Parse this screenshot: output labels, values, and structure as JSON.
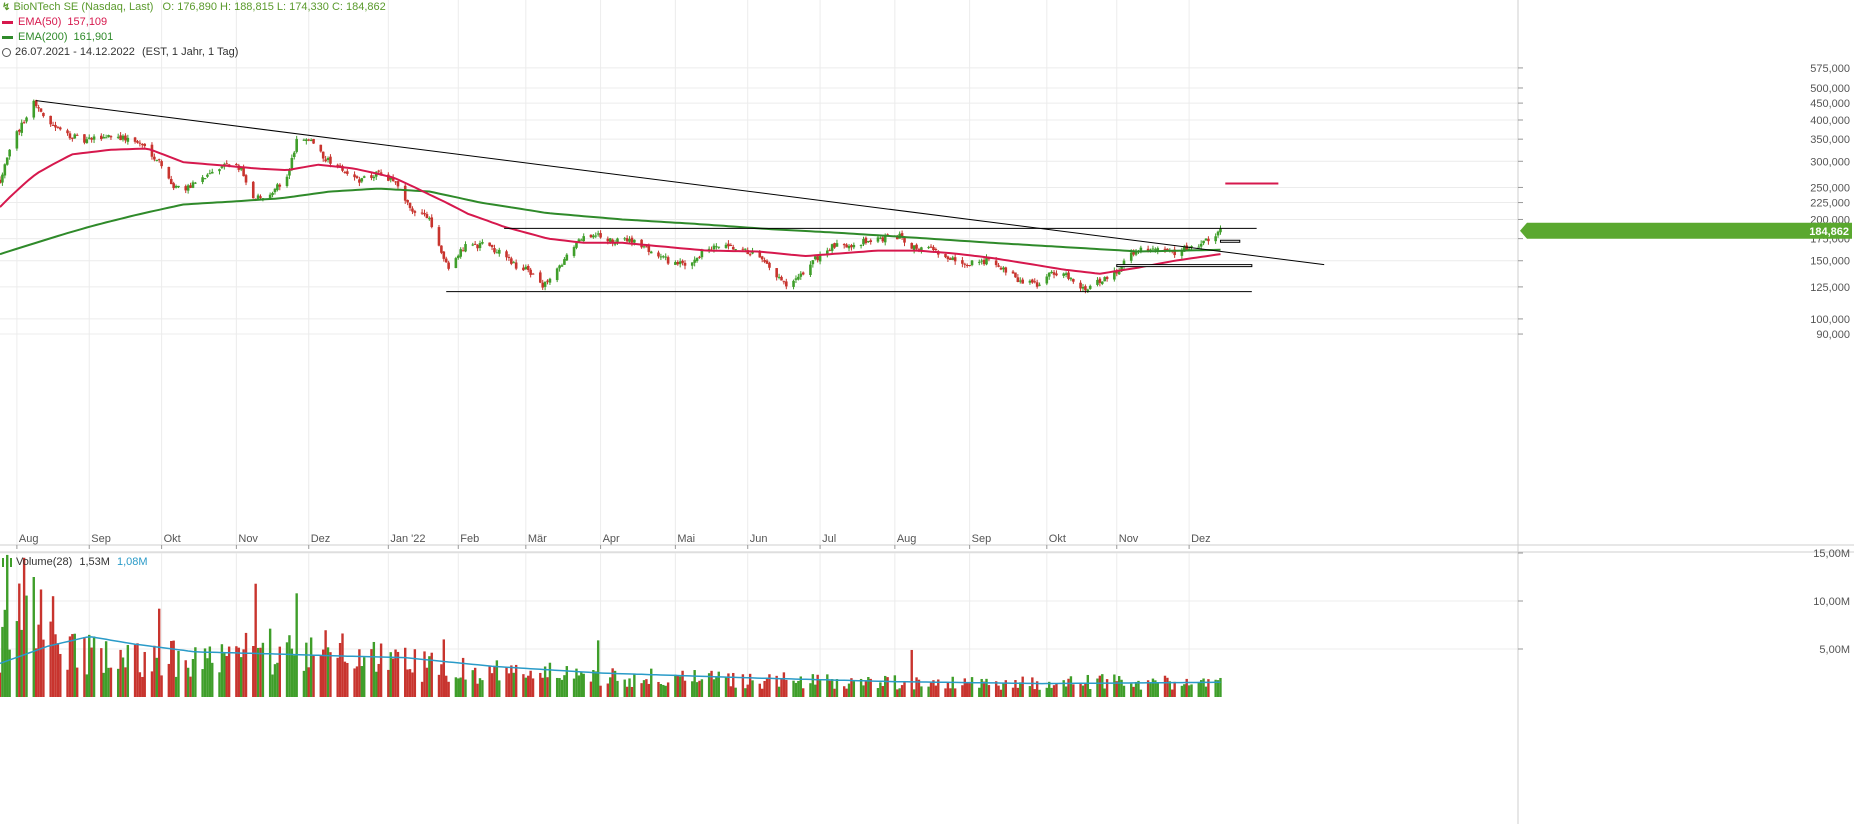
{
  "header": {
    "instrument": "BioNTech SE (Nasdaq, Last)",
    "ohlc": "O: 176,890  H: 188,815  L: 174,330  C: 184,862",
    "ema50_label": "EMA(50)",
    "ema50_value": "157,109",
    "ema200_label": "EMA(200)",
    "ema200_value": "161,901",
    "range": "26.07.2021 - 14.12.2022",
    "range_detail": "(EST, 1 Jahr, 1 Tag)"
  },
  "volume_header": {
    "label": "Volume(28)",
    "value1": "1,53M",
    "value2": "1,08M"
  },
  "colors": {
    "up": "#3f9e2a",
    "down": "#c8342e",
    "ema50": "#d6184d",
    "ema200": "#2f8a2a",
    "vol_avg": "#2a9bc8",
    "grid": "#ececec",
    "text": "#555555",
    "header_instrument": "#5a9a2c",
    "last_price_bg": "#5aa82f"
  },
  "chart_data": [
    {
      "type": "candlestick",
      "title": "BioNTech SE (Nasdaq, Last)",
      "scale": "log",
      "ylim": [
        85,
        600
      ],
      "xlim": [
        "2021-07-26",
        "2022-12-14"
      ],
      "y_ticks": [
        {
          "value": 575,
          "label": "575,000"
        },
        {
          "value": 500,
          "label": "500,000"
        },
        {
          "value": 450,
          "label": "450,000"
        },
        {
          "value": 400,
          "label": "400,000"
        },
        {
          "value": 350,
          "label": "350,000"
        },
        {
          "value": 300,
          "label": "300,000"
        },
        {
          "value": 250,
          "label": "250,000"
        },
        {
          "value": 225,
          "label": "225,000"
        },
        {
          "value": 200,
          "label": "200,000"
        },
        {
          "value": 175,
          "label": "175,000"
        },
        {
          "value": 150,
          "label": "150,000"
        },
        {
          "value": 125,
          "label": "125,000"
        },
        {
          "value": 100,
          "label": "100,000"
        },
        {
          "value": 90,
          "label": "90,000"
        }
      ],
      "x_ticks": [
        {
          "date": "2021-08-02",
          "label": "Aug"
        },
        {
          "date": "2021-09-01",
          "label": "Sep"
        },
        {
          "date": "2021-10-01",
          "label": "Okt"
        },
        {
          "date": "2021-11-01",
          "label": "Nov"
        },
        {
          "date": "2021-12-01",
          "label": "Dez"
        },
        {
          "date": "2022-01-03",
          "label": "Jan '22"
        },
        {
          "date": "2022-02-01",
          "label": "Feb"
        },
        {
          "date": "2022-03-01",
          "label": "Mär"
        },
        {
          "date": "2022-04-01",
          "label": "Apr"
        },
        {
          "date": "2022-05-02",
          "label": "Mai"
        },
        {
          "date": "2022-06-01",
          "label": "Jun"
        },
        {
          "date": "2022-07-01",
          "label": "Jul"
        },
        {
          "date": "2022-08-01",
          "label": "Aug"
        },
        {
          "date": "2022-09-01",
          "label": "Sep"
        },
        {
          "date": "2022-10-03",
          "label": "Okt"
        },
        {
          "date": "2022-11-01",
          "label": "Nov"
        },
        {
          "date": "2022-12-01",
          "label": "Dez"
        }
      ],
      "price_anchors": [
        {
          "date": "2021-07-26",
          "close": 262
        },
        {
          "date": "2021-07-30",
          "close": 330
        },
        {
          "date": "2021-08-04",
          "close": 385
        },
        {
          "date": "2021-08-09",
          "close": 455
        },
        {
          "date": "2021-08-13",
          "close": 410
        },
        {
          "date": "2021-08-20",
          "close": 370
        },
        {
          "date": "2021-08-30",
          "close": 345
        },
        {
          "date": "2021-09-10",
          "close": 360
        },
        {
          "date": "2021-09-20",
          "close": 345
        },
        {
          "date": "2021-09-24",
          "close": 332
        },
        {
          "date": "2021-09-30",
          "close": 300
        },
        {
          "date": "2021-10-05",
          "close": 252
        },
        {
          "date": "2021-10-12",
          "close": 250
        },
        {
          "date": "2021-10-20",
          "close": 270
        },
        {
          "date": "2021-10-27",
          "close": 290
        },
        {
          "date": "2021-11-03",
          "close": 288
        },
        {
          "date": "2021-11-08",
          "close": 228
        },
        {
          "date": "2021-11-15",
          "close": 240
        },
        {
          "date": "2021-11-22",
          "close": 265
        },
        {
          "date": "2021-11-26",
          "close": 345
        },
        {
          "date": "2021-12-01",
          "close": 355
        },
        {
          "date": "2021-12-08",
          "close": 305
        },
        {
          "date": "2021-12-15",
          "close": 285
        },
        {
          "date": "2021-12-22",
          "close": 262
        },
        {
          "date": "2021-12-30",
          "close": 275
        },
        {
          "date": "2022-01-05",
          "close": 260
        },
        {
          "date": "2022-01-12",
          "close": 215
        },
        {
          "date": "2022-01-19",
          "close": 205
        },
        {
          "date": "2022-01-25",
          "close": 160
        },
        {
          "date": "2022-01-28",
          "close": 145
        },
        {
          "date": "2022-02-04",
          "close": 165
        },
        {
          "date": "2022-02-11",
          "close": 168
        },
        {
          "date": "2022-02-18",
          "close": 160
        },
        {
          "date": "2022-02-25",
          "close": 145
        },
        {
          "date": "2022-03-04",
          "close": 138
        },
        {
          "date": "2022-03-08",
          "close": 126
        },
        {
          "date": "2022-03-15",
          "close": 142
        },
        {
          "date": "2022-03-22",
          "close": 170
        },
        {
          "date": "2022-03-30",
          "close": 182
        },
        {
          "date": "2022-04-06",
          "close": 170
        },
        {
          "date": "2022-04-13",
          "close": 175
        },
        {
          "date": "2022-04-22",
          "close": 160
        },
        {
          "date": "2022-04-29",
          "close": 150
        },
        {
          "date": "2022-05-06",
          "close": 145
        },
        {
          "date": "2022-05-13",
          "close": 158
        },
        {
          "date": "2022-05-20",
          "close": 166
        },
        {
          "date": "2022-05-27",
          "close": 162
        },
        {
          "date": "2022-06-03",
          "close": 158
        },
        {
          "date": "2022-06-10",
          "close": 142
        },
        {
          "date": "2022-06-17",
          "close": 125
        },
        {
          "date": "2022-06-22",
          "close": 132
        },
        {
          "date": "2022-06-28",
          "close": 150
        },
        {
          "date": "2022-07-06",
          "close": 165
        },
        {
          "date": "2022-07-13",
          "close": 168
        },
        {
          "date": "2022-07-20",
          "close": 172
        },
        {
          "date": "2022-07-27",
          "close": 175
        },
        {
          "date": "2022-08-03",
          "close": 178
        },
        {
          "date": "2022-08-10",
          "close": 162
        },
        {
          "date": "2022-08-17",
          "close": 162
        },
        {
          "date": "2022-08-24",
          "close": 152
        },
        {
          "date": "2022-08-31",
          "close": 148
        },
        {
          "date": "2022-09-08",
          "close": 150
        },
        {
          "date": "2022-09-15",
          "close": 140
        },
        {
          "date": "2022-09-22",
          "close": 130
        },
        {
          "date": "2022-09-29",
          "close": 128
        },
        {
          "date": "2022-10-06",
          "close": 138
        },
        {
          "date": "2022-10-13",
          "close": 134
        },
        {
          "date": "2022-10-19",
          "close": 122
        },
        {
          "date": "2022-10-24",
          "close": 130
        },
        {
          "date": "2022-10-31",
          "close": 137
        },
        {
          "date": "2022-11-04",
          "close": 150
        },
        {
          "date": "2022-11-10",
          "close": 163
        },
        {
          "date": "2022-11-17",
          "close": 162
        },
        {
          "date": "2022-11-24",
          "close": 158
        },
        {
          "date": "2022-12-01",
          "close": 165
        },
        {
          "date": "2022-12-07",
          "close": 170
        },
        {
          "date": "2022-12-12",
          "close": 178
        },
        {
          "date": "2022-12-14",
          "close": 184.862
        }
      ],
      "ema50_anchors": [
        {
          "date": "2021-07-26",
          "value": 218
        },
        {
          "date": "2021-08-10",
          "value": 275
        },
        {
          "date": "2021-08-25",
          "value": 315
        },
        {
          "date": "2021-09-10",
          "value": 325
        },
        {
          "date": "2021-09-25",
          "value": 328
        },
        {
          "date": "2021-10-10",
          "value": 298
        },
        {
          "date": "2021-10-25",
          "value": 292
        },
        {
          "date": "2021-11-10",
          "value": 285
        },
        {
          "date": "2021-11-22",
          "value": 282
        },
        {
          "date": "2021-12-05",
          "value": 293
        },
        {
          "date": "2021-12-20",
          "value": 285
        },
        {
          "date": "2022-01-05",
          "value": 268
        },
        {
          "date": "2022-01-20",
          "value": 238
        },
        {
          "date": "2022-02-05",
          "value": 208
        },
        {
          "date": "2022-02-20",
          "value": 190
        },
        {
          "date": "2022-03-10",
          "value": 175
        },
        {
          "date": "2022-03-25",
          "value": 170
        },
        {
          "date": "2022-04-10",
          "value": 170
        },
        {
          "date": "2022-04-25",
          "value": 166
        },
        {
          "date": "2022-05-15",
          "value": 161
        },
        {
          "date": "2022-06-05",
          "value": 160
        },
        {
          "date": "2022-06-25",
          "value": 155
        },
        {
          "date": "2022-07-10",
          "value": 158
        },
        {
          "date": "2022-07-25",
          "value": 161
        },
        {
          "date": "2022-08-10",
          "value": 161
        },
        {
          "date": "2022-08-25",
          "value": 158
        },
        {
          "date": "2022-09-10",
          "value": 153
        },
        {
          "date": "2022-09-25",
          "value": 147
        },
        {
          "date": "2022-10-10",
          "value": 141
        },
        {
          "date": "2022-10-25",
          "value": 137
        },
        {
          "date": "2022-11-10",
          "value": 143
        },
        {
          "date": "2022-11-25",
          "value": 150
        },
        {
          "date": "2022-12-14",
          "value": 157.109
        }
      ],
      "ema200_anchors": [
        {
          "date": "2021-07-26",
          "value": 157
        },
        {
          "date": "2021-08-10",
          "value": 170
        },
        {
          "date": "2021-09-01",
          "value": 190
        },
        {
          "date": "2021-09-20",
          "value": 206
        },
        {
          "date": "2021-10-10",
          "value": 222
        },
        {
          "date": "2021-11-01",
          "value": 227
        },
        {
          "date": "2021-11-20",
          "value": 232
        },
        {
          "date": "2021-12-10",
          "value": 243
        },
        {
          "date": "2021-12-30",
          "value": 248
        },
        {
          "date": "2022-01-20",
          "value": 243
        },
        {
          "date": "2022-02-10",
          "value": 225
        },
        {
          "date": "2022-03-10",
          "value": 209
        },
        {
          "date": "2022-04-10",
          "value": 200
        },
        {
          "date": "2022-05-10",
          "value": 194
        },
        {
          "date": "2022-06-10",
          "value": 187
        },
        {
          "date": "2022-07-10",
          "value": 182
        },
        {
          "date": "2022-08-10",
          "value": 176
        },
        {
          "date": "2022-09-10",
          "value": 170
        },
        {
          "date": "2022-10-10",
          "value": 165
        },
        {
          "date": "2022-11-10",
          "value": 160
        },
        {
          "date": "2022-12-14",
          "value": 161.901
        }
      ],
      "trendlines": [
        {
          "name": "falling resistance",
          "from": {
            "date": "2021-08-10",
            "value": 458
          },
          "to": {
            "date": "2023-01-26",
            "value": 146
          },
          "color": "#000000"
        },
        {
          "name": "horizontal resistance",
          "from": {
            "date": "2022-02-20",
            "value": 188
          },
          "to": {
            "date": "2022-12-29",
            "value": 188
          },
          "color": "#000000"
        },
        {
          "name": "horizontal support",
          "from": {
            "date": "2022-01-27",
            "value": 121
          },
          "to": {
            "date": "2022-12-27",
            "value": 121
          },
          "color": "#000000"
        },
        {
          "name": "target line",
          "from": {
            "date": "2022-12-16",
            "value": 257
          },
          "to": {
            "date": "2023-01-07",
            "value": 257
          },
          "color": "#d6184d"
        }
      ],
      "zones": [
        {
          "from_date": "2022-12-14",
          "to_date": "2022-12-22",
          "low": 171,
          "high": 173
        },
        {
          "from_date": "2022-11-01",
          "to_date": "2022-12-27",
          "low": 144,
          "high": 146
        }
      ],
      "last_price": {
        "value": 184.862,
        "label": "184,862"
      }
    },
    {
      "type": "bar",
      "title": "Volume(28)",
      "ylim": [
        0,
        15
      ],
      "y_unit": "M",
      "y_ticks": [
        {
          "value": 15,
          "label": "15,00M"
        },
        {
          "value": 10,
          "label": "10,00M"
        },
        {
          "value": 5,
          "label": "5,00M"
        }
      ],
      "volume_anchors": [
        {
          "date": "2021-07-26",
          "value": 5.5
        },
        {
          "date": "2021-08-01",
          "value": 8
        },
        {
          "date": "2021-08-10",
          "value": 10
        },
        {
          "date": "2021-08-20",
          "value": 6
        },
        {
          "date": "2021-09-10",
          "value": 4
        },
        {
          "date": "2021-10-10",
          "value": 4.2
        },
        {
          "date": "2021-11-10",
          "value": 5
        },
        {
          "date": "2021-12-01",
          "value": 5.2
        },
        {
          "date": "2022-01-15",
          "value": 3.5
        },
        {
          "date": "2022-03-01",
          "value": 2.6
        },
        {
          "date": "2022-05-01",
          "value": 2.0
        },
        {
          "date": "2022-07-01",
          "value": 1.7
        },
        {
          "date": "2022-09-01",
          "value": 1.5
        },
        {
          "date": "2022-11-01",
          "value": 1.7
        },
        {
          "date": "2022-12-14",
          "value": 1.6
        }
      ],
      "volume_avg_anchors": [
        {
          "date": "2021-07-26",
          "value": 3.5
        },
        {
          "date": "2021-08-15",
          "value": 5.3
        },
        {
          "date": "2021-09-01",
          "value": 6.3
        },
        {
          "date": "2021-09-20",
          "value": 5.5
        },
        {
          "date": "2021-10-15",
          "value": 4.7
        },
        {
          "date": "2021-11-15",
          "value": 4.5
        },
        {
          "date": "2021-12-10",
          "value": 4.3
        },
        {
          "date": "2022-01-10",
          "value": 4.1
        },
        {
          "date": "2022-02-15",
          "value": 3.2
        },
        {
          "date": "2022-04-01",
          "value": 2.5
        },
        {
          "date": "2022-06-01",
          "value": 2.0
        },
        {
          "date": "2022-08-01",
          "value": 1.6
        },
        {
          "date": "2022-10-01",
          "value": 1.4
        },
        {
          "date": "2022-12-14",
          "value": 1.53
        }
      ],
      "volume_spikes": [
        {
          "date": "2021-07-29",
          "value": 14.8
        },
        {
          "date": "2021-08-05",
          "value": 14.5
        },
        {
          "date": "2021-08-09",
          "value": 12.5
        },
        {
          "date": "2021-08-12",
          "value": 11.2
        },
        {
          "date": "2021-08-17",
          "value": 10.5
        },
        {
          "date": "2021-09-30",
          "value": 9.2
        },
        {
          "date": "2021-11-09",
          "value": 11.8
        },
        {
          "date": "2021-11-26",
          "value": 10.8
        },
        {
          "date": "2022-01-26",
          "value": 6.0
        },
        {
          "date": "2022-03-31",
          "value": 5.9
        },
        {
          "date": "2022-08-08",
          "value": 4.9
        }
      ]
    }
  ]
}
